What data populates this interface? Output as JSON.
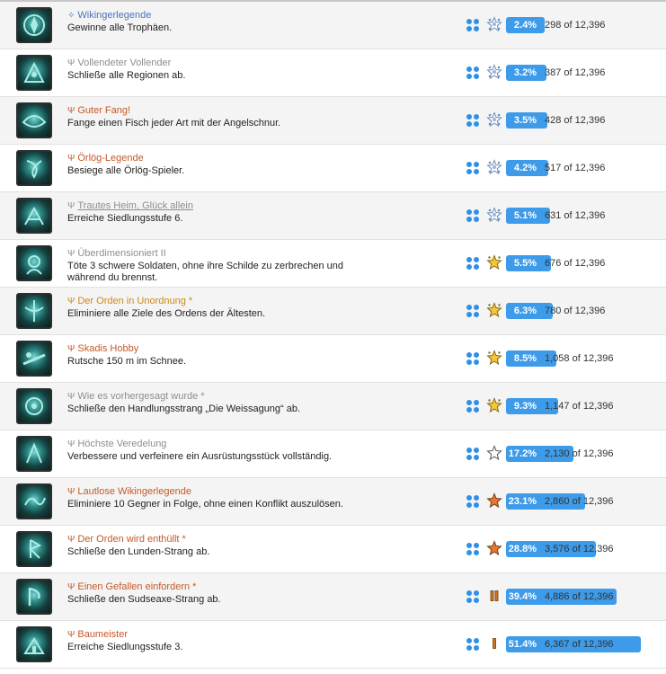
{
  "colors": {
    "accent_blue": "#3d9be9",
    "platinum": "#4a74b8",
    "gold": "#cc8a1c",
    "silver": "#8e8e8e",
    "bronze": "#c45a28"
  },
  "total_owners": "12,396",
  "of_label": "of",
  "trophies": [
    {
      "title": "Wikingerlegende",
      "desc": "Gewinne alle Trophäen.",
      "grade": "platinum",
      "rarity_icon": "ultra-rare-icon",
      "pct": "2.4%",
      "pct_value": 2.4,
      "owners": "298"
    },
    {
      "title": "Vollendeter Vollender",
      "desc": "Schließe alle Regionen ab.",
      "grade": "silver",
      "rarity_icon": "ultra-rare-icon",
      "pct": "3.2%",
      "pct_value": 3.2,
      "owners": "387"
    },
    {
      "title": "Guter Fang!",
      "desc": "Fange einen Fisch jeder Art mit der Angelschnur.",
      "grade": "bronze",
      "rarity_icon": "ultra-rare-icon",
      "pct": "3.5%",
      "pct_value": 3.5,
      "owners": "428"
    },
    {
      "title": "Örlög-Legende",
      "desc": "Besiege alle Örlög-Spieler.",
      "grade": "bronze",
      "rarity_icon": "ultra-rare-icon",
      "pct": "4.2%",
      "pct_value": 4.2,
      "owners": "517"
    },
    {
      "title": "Trautes Heim, Glück allein",
      "desc": "Erreiche Siedlungsstufe 6.",
      "grade": "silver",
      "linked": true,
      "rarity_icon": "ultra-rare-icon",
      "pct": "5.1%",
      "pct_value": 5.1,
      "owners": "631"
    },
    {
      "title": "Überdimensioniert II",
      "desc": "Töte 3 schwere Soldaten, ohne ihre Schilde zu zerbrechen und während du brennst.",
      "grade": "silver",
      "rarity_icon": "very-rare-icon",
      "pct": "5.5%",
      "pct_value": 5.5,
      "owners": "676"
    },
    {
      "title": "Der Orden in Unordnung *",
      "desc": "Eliminiere alle Ziele des Ordens der Ältesten.",
      "grade": "gold",
      "rarity_icon": "very-rare-icon",
      "pct": "6.3%",
      "pct_value": 6.3,
      "owners": "780"
    },
    {
      "title": "Skadis Hobby",
      "desc": "Rutsche 150 m im Schnee.",
      "grade": "bronze",
      "rarity_icon": "very-rare-icon",
      "pct": "8.5%",
      "pct_value": 8.5,
      "owners": "1,058"
    },
    {
      "title": "Wie es vorhergesagt wurde *",
      "desc": "Schließe den Handlungsstrang „Die Weissagung“ ab.",
      "grade": "silver",
      "rarity_icon": "very-rare-icon",
      "pct": "9.3%",
      "pct_value": 9.3,
      "owners": "1,147"
    },
    {
      "title": "Höchste Veredelung",
      "desc": "Verbessere und verfeinere ein Ausrüstungsstück vollständig.",
      "grade": "silver",
      "rarity_icon": "rare-icon",
      "pct": "17.2%",
      "pct_value": 17.2,
      "owners": "2,130"
    },
    {
      "title": "Lautlose Wikingerlegende",
      "desc": "Eliminiere 10 Gegner in Folge, ohne einen Konflikt auszulösen.",
      "grade": "bronze",
      "rarity_icon": "uncommon-icon",
      "pct": "23.1%",
      "pct_value": 23.1,
      "owners": "2,860"
    },
    {
      "title": "Der Orden wird enthüllt *",
      "desc": "Schließe den Lunden-Strang ab.",
      "grade": "bronze",
      "rarity_icon": "uncommon-icon",
      "pct": "28.8%",
      "pct_value": 28.8,
      "owners": "3,576"
    },
    {
      "title": "Einen Gefallen einfordern *",
      "desc": "Schließe den Sudseaxe-Strang ab.",
      "grade": "bronze",
      "rarity_icon": "common-icon",
      "pct": "39.4%",
      "pct_value": 39.4,
      "owners": "4,886"
    },
    {
      "title": "Baumeister",
      "desc": "Erreiche Siedlungsstufe 3.",
      "grade": "bronze",
      "rarity_icon": "very-common-icon",
      "pct": "51.4%",
      "pct_value": 51.4,
      "owners": "6,367"
    }
  ]
}
